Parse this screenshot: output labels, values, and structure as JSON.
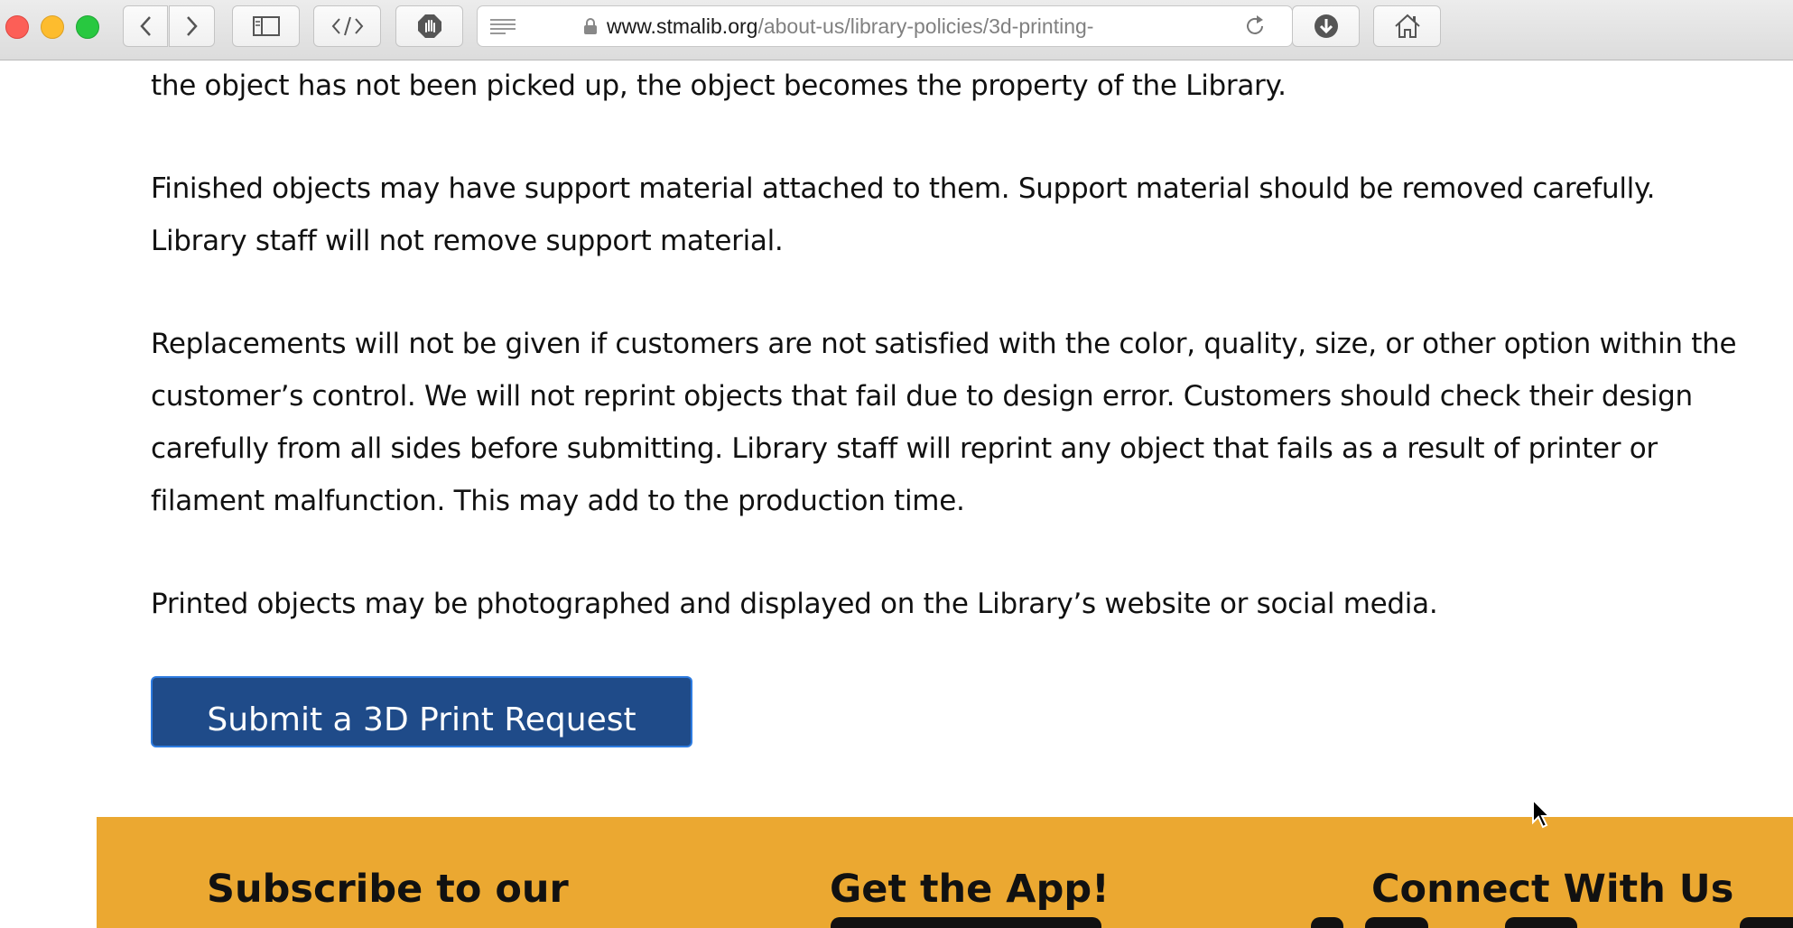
{
  "browser": {
    "url_host": "www.stmalib.org",
    "url_path": "/about-us/library-policies/3d-printing-"
  },
  "content": {
    "paragraphs": [
      [
        "the object has not been picked up, the object becomes the property of the Library."
      ],
      [
        "Finished objects may have support material attached to them. Support material should be removed carefully.",
        "Library staff will not remove support material."
      ],
      [
        "Replacements will not be given if customers are not satisfied with the color, quality, size, or other option within the",
        "customer’s control. We will not reprint objects that fail due to design error. Customers should check their design",
        "carefully from all sides before submitting. Library staff will reprint any object that fails as a result of printer or",
        "filament malfunction. This may add to the production time."
      ],
      [
        "Printed objects may be photographed and displayed on the Library’s website or social media."
      ]
    ],
    "submit_button": "Submit a 3D Print Request"
  },
  "footer": {
    "background": "#eba831",
    "newsletter_heading": "Subscribe to our",
    "app_heading": "Get the App!",
    "social_heading": "Connect With Us"
  },
  "colors": {
    "button_bg": "#1f4b89",
    "button_border": "#2d7be0"
  }
}
